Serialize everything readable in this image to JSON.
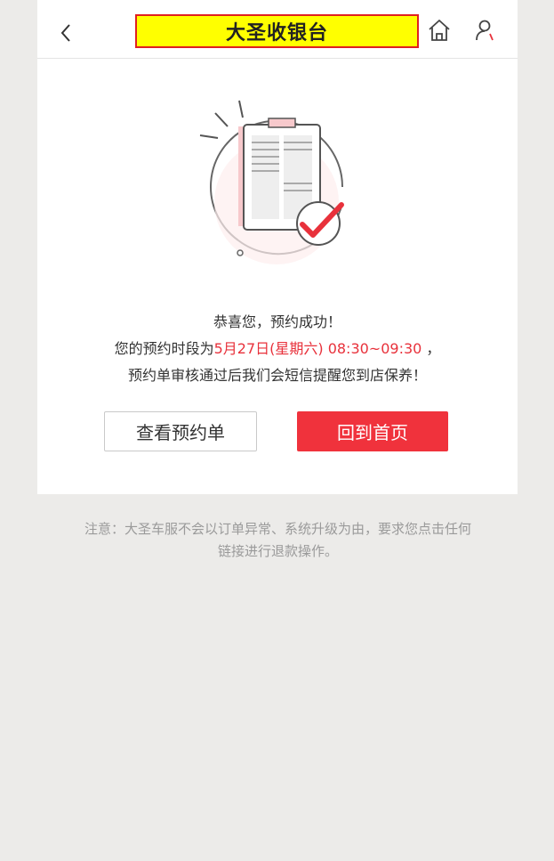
{
  "header": {
    "title": "大圣收银台",
    "back_icon": "chevron-left-icon",
    "home_icon": "home-icon",
    "user_icon": "user-icon"
  },
  "main": {
    "illustration": "clipboard-checkmark-icon",
    "congrats": "恭喜您，预约成功！",
    "slot_prefix": "您的预约时段为",
    "slot_value": "5月27日(星期六) 08:30~09:30",
    "slot_suffix": " ，",
    "review_note": "预约单审核通过后我们会短信提醒您到店保养！",
    "view_button": "查看预约单",
    "home_button": "回到首页"
  },
  "footer": {
    "notice": "注意：大圣车服不会以订单异常、系统升级为由，要求您点击任何链接进行退款操作。"
  },
  "colors": {
    "accent": "#f0323c",
    "highlight_text": "#e8313b",
    "title_bg": "#ffff00",
    "title_border": "#e02020"
  }
}
